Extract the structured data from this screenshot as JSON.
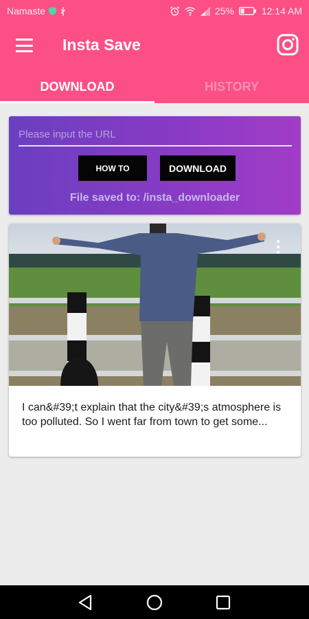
{
  "status_bar": {
    "carrier": "Namaste",
    "battery_percent": "25%",
    "time": "12:14 AM"
  },
  "app_bar": {
    "title": "Insta Save",
    "menu_icon": "hamburger-menu-icon",
    "right_icon": "instagram-icon"
  },
  "tabs": [
    {
      "label": "DOWNLOAD",
      "active": true
    },
    {
      "label": "HISTORY",
      "active": false
    }
  ],
  "url_card": {
    "input_value": "",
    "input_placeholder": "Please input the URL",
    "how_to_label": "HOW TO",
    "download_label": "DOWNLOAD",
    "saved_path_text": "File saved to: /insta_downloader"
  },
  "post": {
    "caption": "I can&#39;t explain that the city&#39;s atmosphere is too polluted. So I went far from town to get some...",
    "more_icon": "more-vertical-icon"
  },
  "nav_bar": {
    "back_icon": "back-icon",
    "home_icon": "home-icon",
    "recents_icon": "recents-icon"
  },
  "colors": {
    "accent": "#fc4f86",
    "card_gradient_start": "#6b3fc0",
    "card_gradient_end": "#a13cc7",
    "background": "#ececec"
  }
}
